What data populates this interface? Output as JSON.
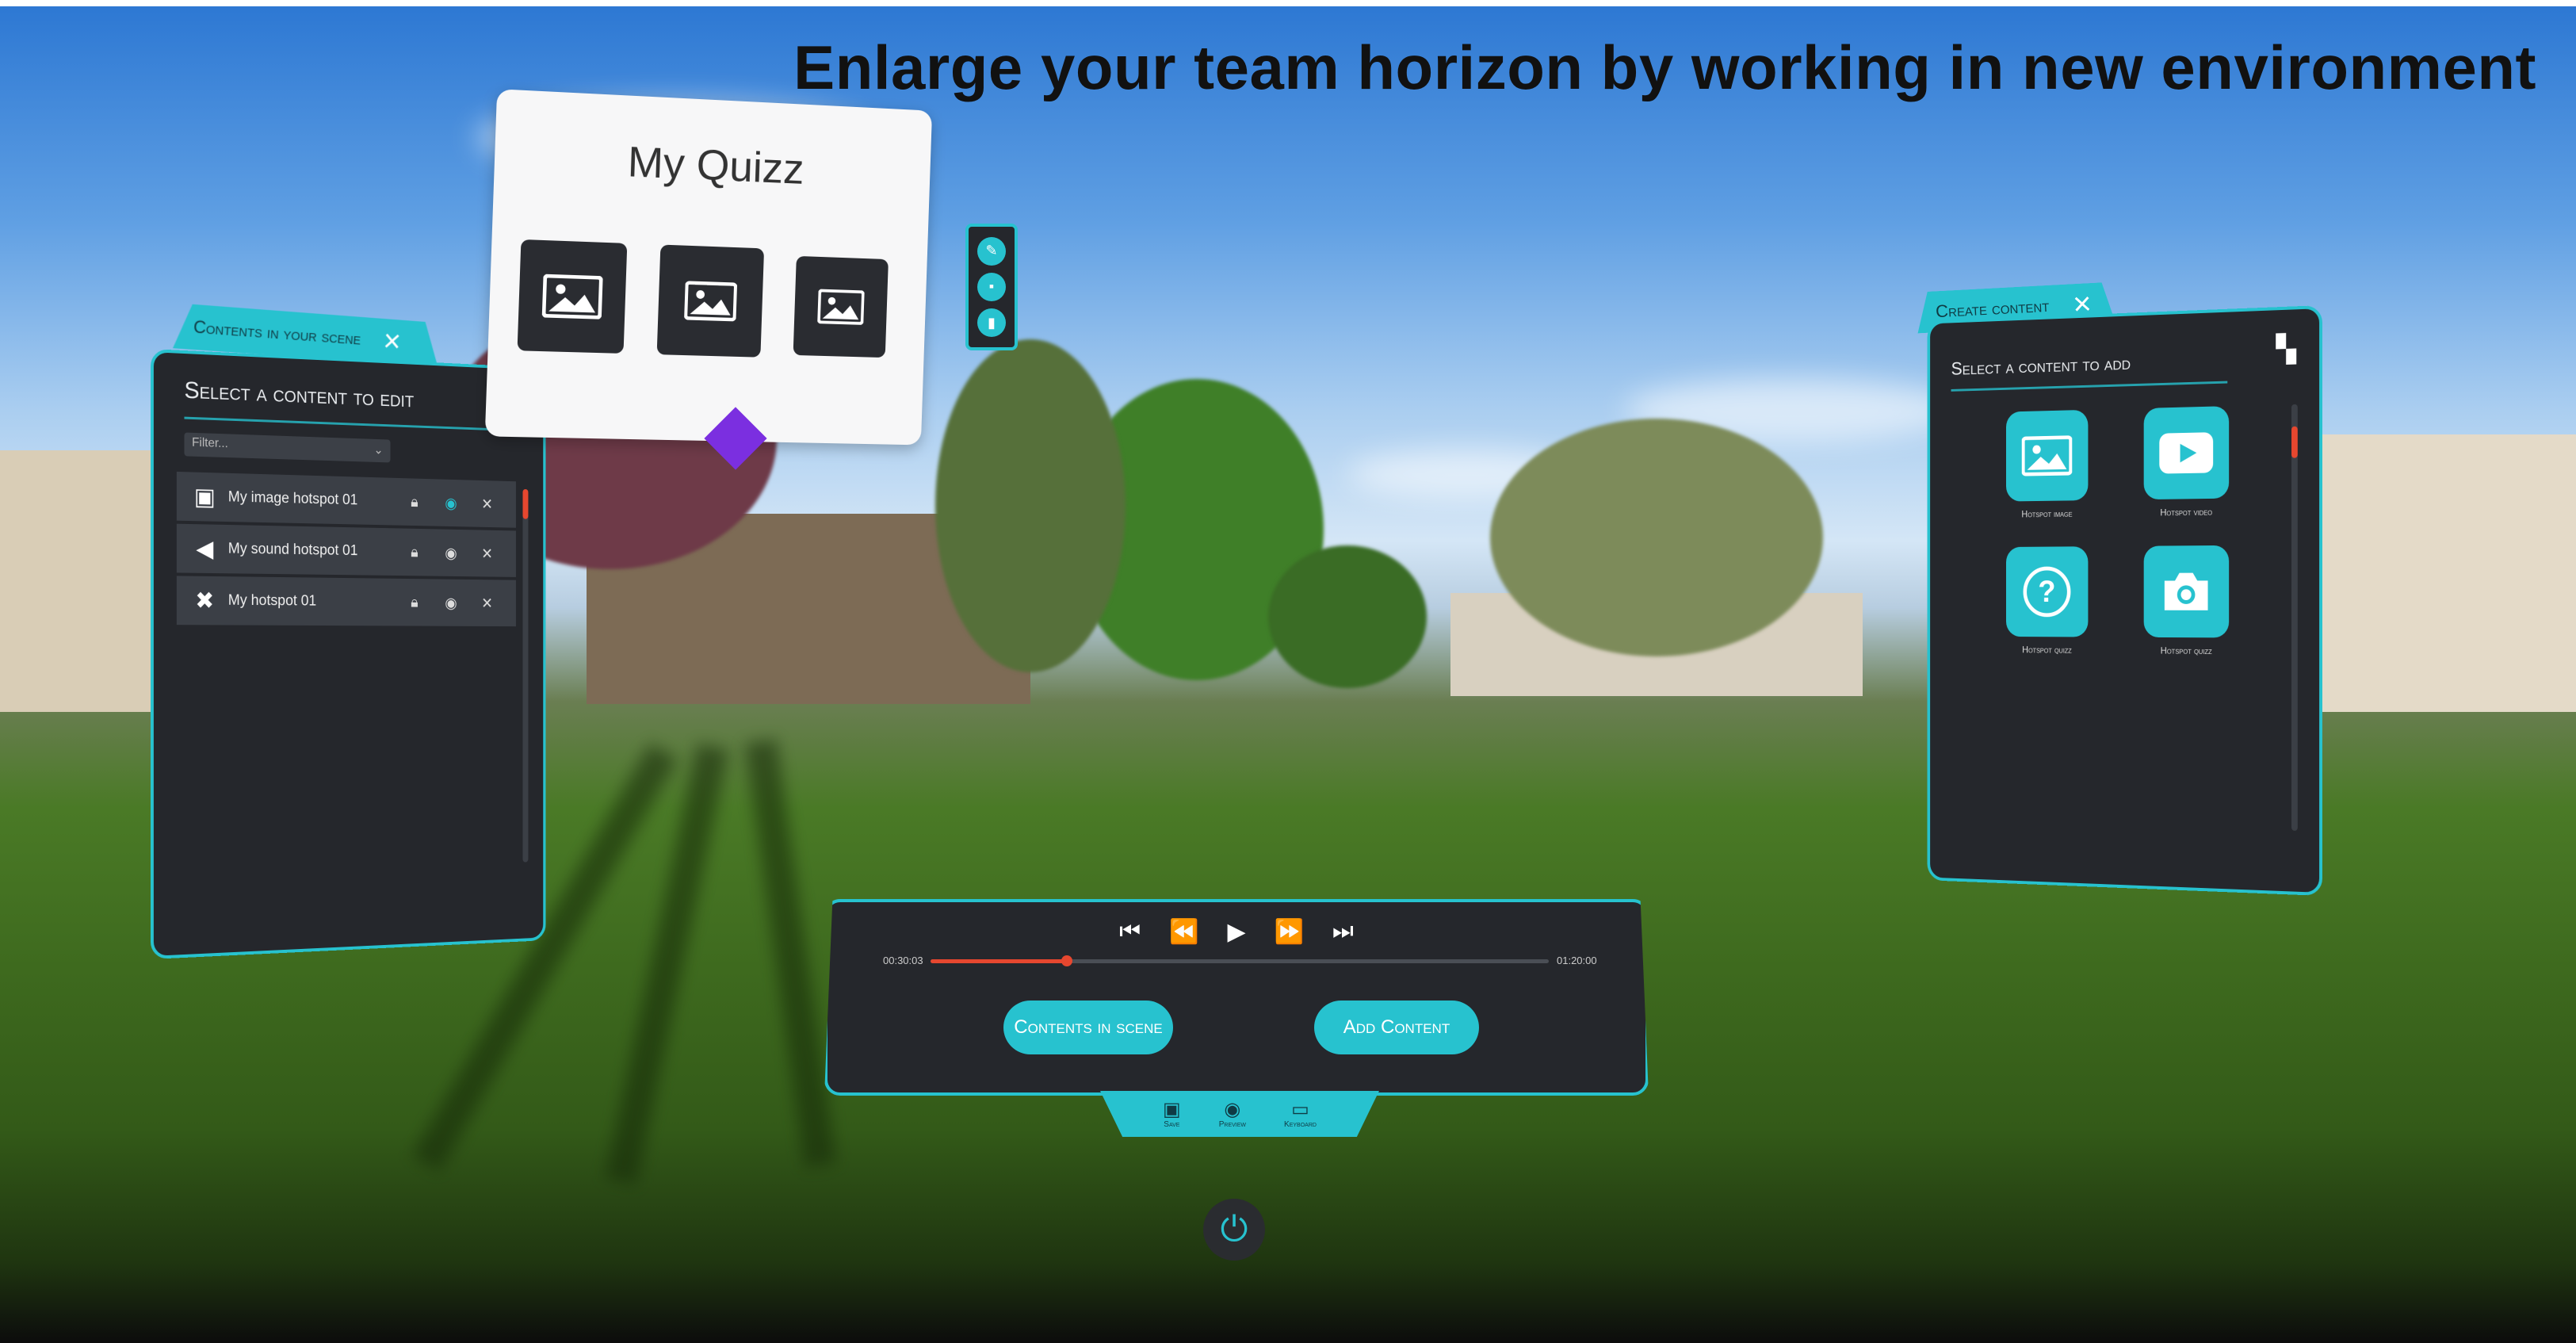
{
  "headline": "Enlarge your team horizon by working in new environment",
  "colors": {
    "accent": "#27c2cf",
    "panel": "#25272c",
    "progress": "#e6472f",
    "diamond": "#7b2fe0"
  },
  "left_panel": {
    "tab_label": "Contents in your scene",
    "title": "Select a content to edit",
    "filter_placeholder": "Filter...",
    "items": [
      {
        "icon": "image-icon",
        "label": "My image hotspot 01"
      },
      {
        "icon": "sound-icon",
        "label": "My sound hotspot 01"
      },
      {
        "icon": "hotspot-icon",
        "label": "My hotspot 01"
      }
    ]
  },
  "quiz_card": {
    "title": "My Quizz"
  },
  "right_panel": {
    "tab_label": "Create content",
    "title": "Select a content to add",
    "items": [
      {
        "icon": "image-icon",
        "label": "Hotspot image"
      },
      {
        "icon": "video-icon",
        "label": "Hotspot video"
      },
      {
        "icon": "quiz-icon",
        "label": "Hotspot quizz"
      },
      {
        "icon": "camera-icon",
        "label": "Hotspot quizz"
      }
    ]
  },
  "player": {
    "current_time": "00:30:03",
    "total_time": "01:20:00",
    "progress": 0.22,
    "contents_button": "Contents in scene",
    "add_button": "Add Content"
  },
  "bottom_tabs": [
    {
      "icon": "save-icon",
      "label": "Save"
    },
    {
      "icon": "preview-icon",
      "label": "Preview"
    },
    {
      "icon": "keyboard-icon",
      "label": "Keyboard"
    }
  ]
}
